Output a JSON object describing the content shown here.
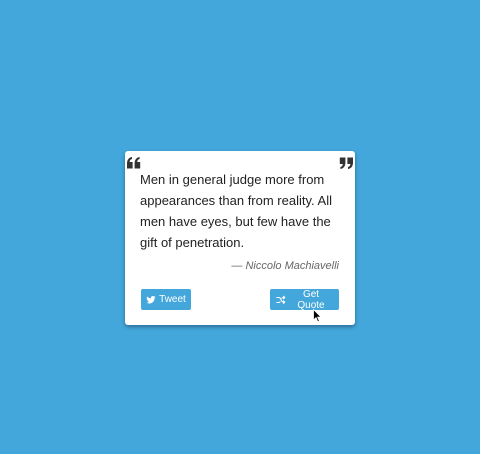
{
  "page": {
    "background_color": "#44a7dc"
  },
  "quote": {
    "text": "Men in general judge more from appearances than from reality. All men have eyes, but few have the gift of penetration.",
    "author": "— Niccolo Machiavelli",
    "open_mark_icon": "quote-left-icon",
    "close_mark_icon": "quote-right-icon"
  },
  "actions": {
    "tweet_label": "Tweet",
    "tweet_icon": "twitter-icon",
    "get_quote_label": "Get Quote",
    "get_quote_icon": "shuffle-icon",
    "accent_color": "#44a7dc"
  },
  "cursor": {
    "icon": "mouse-pointer-icon"
  }
}
